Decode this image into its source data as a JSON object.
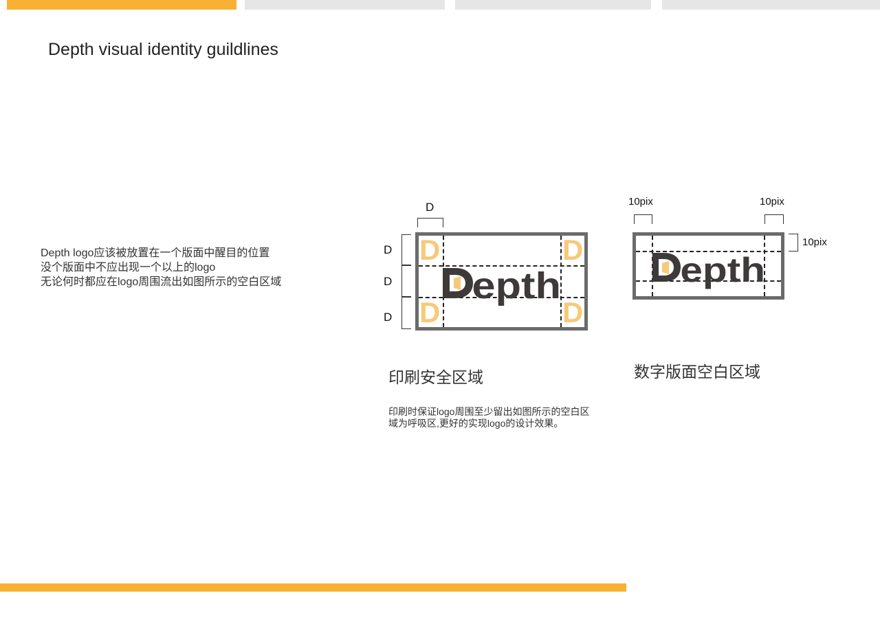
{
  "colors": {
    "accent": "#f8b133",
    "inactive_bar": "#e6e6e6",
    "frame": "#6b6b6b",
    "logo_dark": "#3d3a39",
    "logo_orange": "#f7c97a"
  },
  "progress_bars": [
    {
      "state": "active"
    },
    {
      "state": "inactive"
    },
    {
      "state": "inactive"
    },
    {
      "state": "inactive"
    }
  ],
  "page": {
    "title": "Depth visual identity guildlines"
  },
  "intro": {
    "line1": "Depth logo应该被放置在一个版面中醒目的位置",
    "line2": "没个版面中不应出现一个以上的logo",
    "line3": "无论何时都应在logo周围流出如图所示的空白区域"
  },
  "print_section": {
    "heading": "印刷安全区域",
    "description": "印刷时保证logo周围至少留出如图所示的空白区域为呼吸区,更好的实现logo的设计效果。",
    "measure_top": "D",
    "measure_left": [
      "D",
      "D",
      "D"
    ],
    "corner_glyph": "D",
    "logo_text": "Depth"
  },
  "digital_section": {
    "heading": "数字版面空白区域",
    "label_top_left": "10pix",
    "label_top_right": "10pix",
    "label_right": "10pix",
    "logo_text": "Depth"
  }
}
